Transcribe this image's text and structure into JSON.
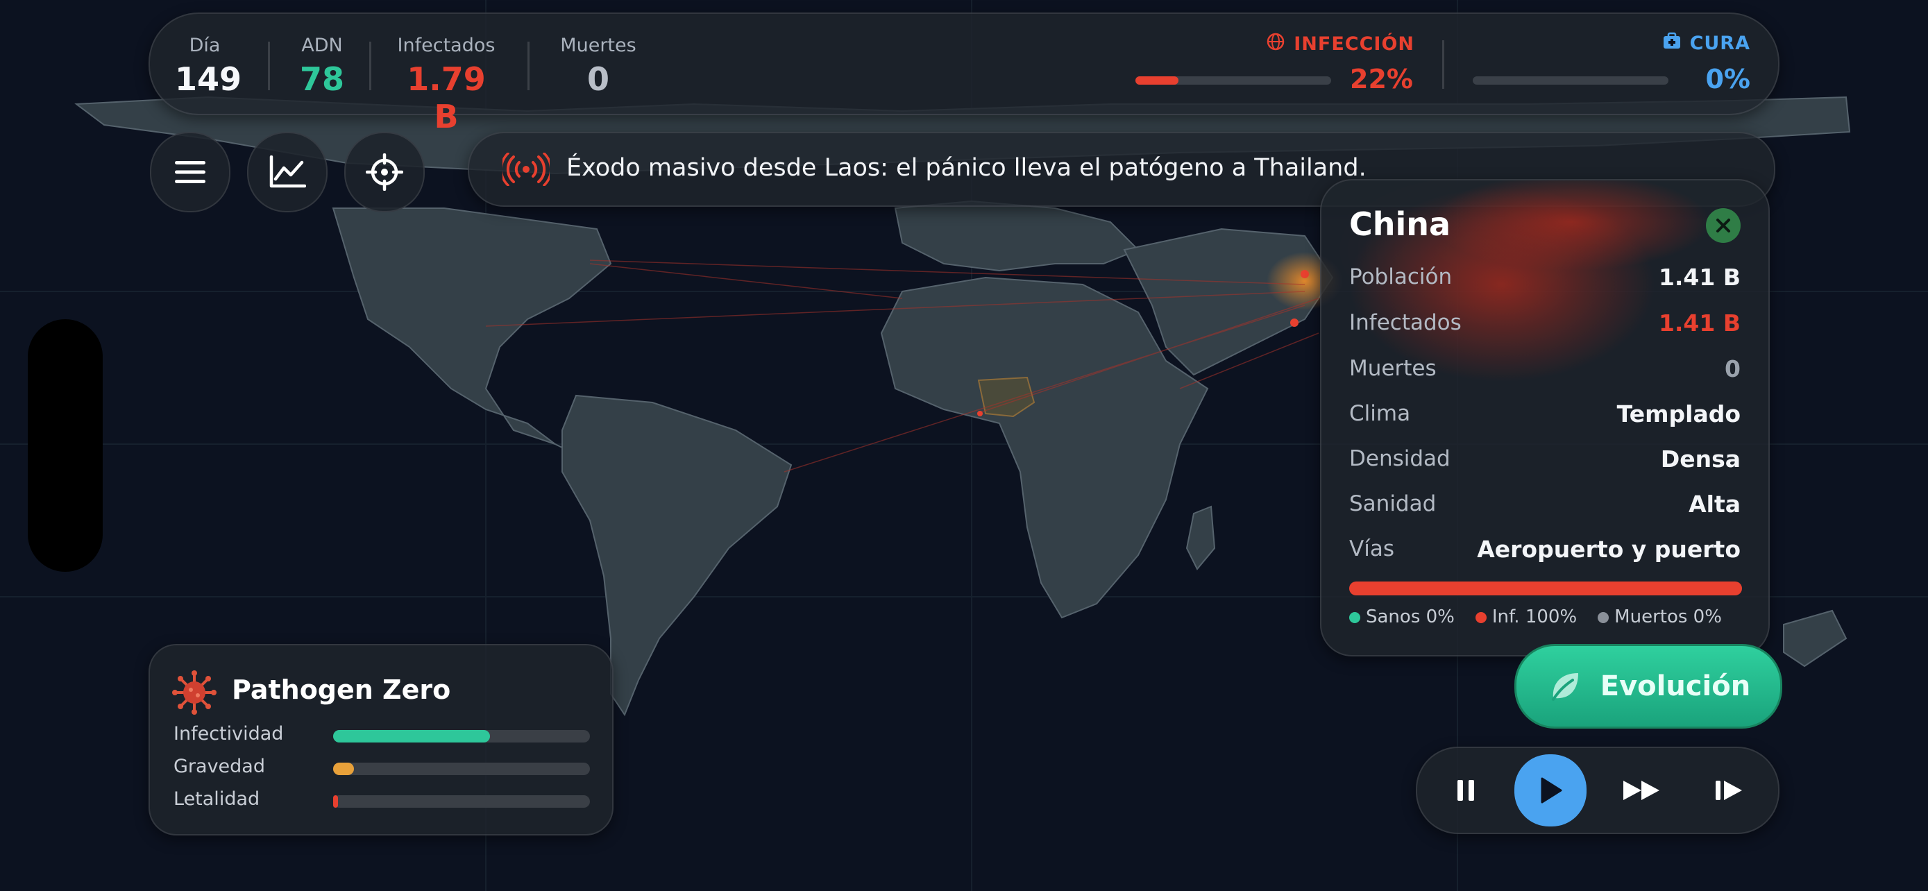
{
  "stats": {
    "day": {
      "label": "Día",
      "value": "149"
    },
    "dna": {
      "label": "ADN",
      "value": "78"
    },
    "infected": {
      "label": "Infectados",
      "value": "1.79 B"
    },
    "deaths": {
      "label": "Muertes",
      "value": "0"
    }
  },
  "infection_meter": {
    "label": "INFECCIÓN",
    "percent_text": "22%",
    "percent": 22,
    "color": "#e8402f",
    "icon": "globe-icon"
  },
  "cure_meter": {
    "label": "CURA",
    "percent_text": "0%",
    "percent": 0,
    "color": "#4aa3f0",
    "icon": "medkit-icon"
  },
  "toolbar": {
    "menu_icon": "hamburger-icon",
    "stats_icon": "line-chart-icon",
    "target_icon": "crosshair-icon"
  },
  "news": {
    "icon": "broadcast-icon",
    "text": "Éxodo masivo desde Laos: el pánico lleva el patógeno a Thailand."
  },
  "country": {
    "name": "China",
    "rows": [
      {
        "key": "Población",
        "value": "1.41 B"
      },
      {
        "key": "Infectados",
        "value": "1.41 B"
      },
      {
        "key": "Muertes",
        "value": "0"
      },
      {
        "key": "Clima",
        "value": "Templado"
      },
      {
        "key": "Densidad",
        "value": "Densa"
      },
      {
        "key": "Sanidad",
        "value": "Alta"
      },
      {
        "key": "Vías",
        "value": "Aeropuerto y puerto"
      }
    ],
    "legend": {
      "healthy": "Sanos 0%",
      "infected": "Inf. 100%",
      "dead": "Muertos 0%"
    },
    "infected_fraction": 1.0
  },
  "evolution_button": {
    "label": "Evolución",
    "icon": "leaf-icon"
  },
  "pathogen": {
    "name": "Pathogen Zero",
    "icon": "virus-icon",
    "traits": [
      {
        "label": "Infectividad",
        "level": 0.61,
        "color": "#2ec79a"
      },
      {
        "label": "Gravedad",
        "level": 0.08,
        "color": "#e8a13a"
      },
      {
        "label": "Letalidad",
        "level": 0.02,
        "color": "#e8402f"
      }
    ]
  },
  "playback": {
    "pause_icon": "pause-icon",
    "play_icon": "play-icon",
    "fast_forward_icon": "fast-forward-icon",
    "skip_icon": "skip-icon"
  }
}
